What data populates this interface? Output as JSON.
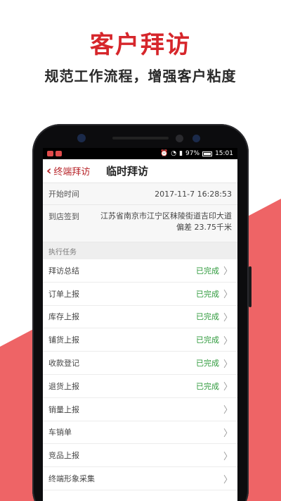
{
  "colors": {
    "brand_red": "#d6262b",
    "accent_pink": "#ee6466",
    "done_green": "#2f9a3c"
  },
  "promo": {
    "headline": "客户拜访",
    "subline": "规范工作流程，增强客户粘度"
  },
  "status_bar": {
    "battery": "97%",
    "time": "15:01"
  },
  "header": {
    "back_label": "终端拜访",
    "title": "临时拜访"
  },
  "visit": {
    "start_label": "开始时间",
    "start_value": "2017-11-7 16:28:53",
    "checkin_label": "到店签到",
    "checkin_address": "江苏省南京市江宁区秣陵街道吉印大道",
    "checkin_offset": "偏差 23.75千米"
  },
  "tasks": {
    "section_title": "执行任务",
    "items": [
      {
        "label": "拜访总结",
        "status": "已完成"
      },
      {
        "label": "订单上报",
        "status": "已完成"
      },
      {
        "label": "库存上报",
        "status": "已完成"
      },
      {
        "label": "铺货上报",
        "status": "已完成"
      },
      {
        "label": "收款登记",
        "status": "已完成"
      },
      {
        "label": "退货上报",
        "status": "已完成"
      },
      {
        "label": "销量上报",
        "status": ""
      },
      {
        "label": "车销单",
        "status": ""
      },
      {
        "label": "竞品上报",
        "status": ""
      },
      {
        "label": "终端形象采集",
        "status": ""
      }
    ]
  }
}
